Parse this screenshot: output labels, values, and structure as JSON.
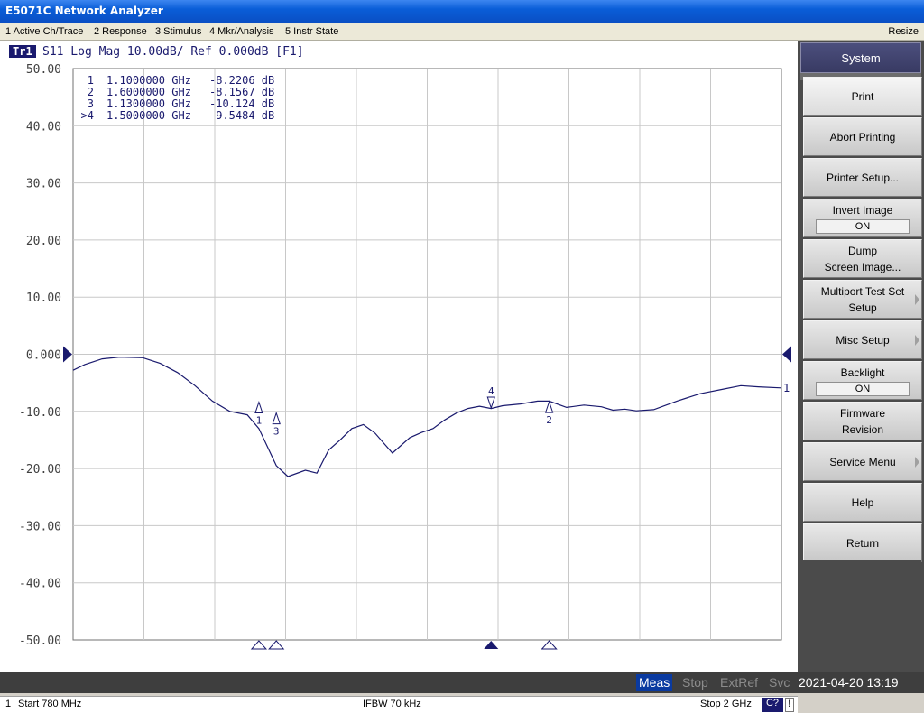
{
  "window": {
    "title": "E5071C Network Analyzer"
  },
  "menubar": {
    "items": [
      "1 Active Ch/Trace",
      "2 Response",
      "3 Stimulus",
      "4 Mkr/Analysis",
      "5 Instr State"
    ],
    "resize": "Resize"
  },
  "trace_header": {
    "tag": "Tr1",
    "text": "S11 Log Mag 10.00dB/ Ref 0.000dB [F1]"
  },
  "markers_table": [
    {
      "num": "1",
      "freq": "1.1000000 GHz",
      "val": "-8.2206 dB"
    },
    {
      "num": "2",
      "freq": "1.6000000 GHz",
      "val": "-8.1567 dB"
    },
    {
      "num": "3",
      "freq": "1.1300000 GHz",
      "val": "-10.124 dB"
    },
    {
      "num": ">4",
      "freq": "1.5000000 GHz",
      "val": "-9.5484 dB"
    }
  ],
  "bottom_bar": {
    "channel": "1",
    "start": "Start 780 MHz",
    "ifbw": "IFBW 70 kHz",
    "stop": "Stop 2 GHz",
    "cal": "C?",
    "warn": "!"
  },
  "softkeys": {
    "title": "System",
    "items": [
      {
        "label": "Print",
        "arrow": false,
        "selected": true
      },
      {
        "label": "Abort Printing",
        "arrow": false
      },
      {
        "label": "Printer Setup...",
        "arrow": false
      },
      {
        "label": "Invert Image",
        "value": "ON",
        "arrow": false
      },
      {
        "label": "Dump\nScreen Image...",
        "arrow": false
      },
      {
        "label": "Multiport Test Set\nSetup",
        "arrow": true
      },
      {
        "label": "Misc Setup",
        "arrow": true
      },
      {
        "label": "Backlight",
        "value": "ON",
        "arrow": false
      },
      {
        "label": "Firmware\nRevision",
        "arrow": false
      },
      {
        "label": "Service Menu",
        "arrow": true
      },
      {
        "label": "Help",
        "arrow": false
      },
      {
        "label": "Return",
        "arrow": false
      }
    ]
  },
  "status": {
    "meas": "Meas",
    "stop": "Stop",
    "extref": "ExtRef",
    "svc": "Svc",
    "datetime": "2021-04-20 13:19"
  },
  "chart_data": {
    "type": "line",
    "title": "",
    "xlabel": "",
    "ylabel": "",
    "x_unit": "GHz",
    "xlim": [
      0.78,
      2.0
    ],
    "ylim": [
      -50,
      50
    ],
    "y_tick_labels": [
      "50.00",
      "40.00",
      "30.00",
      "20.00",
      "10.00",
      "0.000",
      "-10.00",
      "-20.00",
      "-30.00",
      "-40.00",
      "-50.00"
    ],
    "y_ticks": [
      50,
      40,
      30,
      20,
      10,
      0,
      -10,
      -20,
      -30,
      -40,
      -50
    ],
    "grid": true,
    "ref_value": 0,
    "series": [
      {
        "name": "",
        "color": "#1a1a6e",
        "x": [
          0.78,
          0.8,
          0.83,
          0.86,
          0.9,
          0.93,
          0.96,
          0.99,
          1.02,
          1.05,
          1.08,
          1.1,
          1.13,
          1.15,
          1.18,
          1.2,
          1.22,
          1.24,
          1.26,
          1.28,
          1.3,
          1.33,
          1.36,
          1.38,
          1.4,
          1.42,
          1.44,
          1.46,
          1.48,
          1.5,
          1.52,
          1.55,
          1.58,
          1.6,
          1.63,
          1.66,
          1.69,
          1.71,
          1.73,
          1.75,
          1.78,
          1.82,
          1.86,
          1.9,
          1.93,
          1.96,
          2.0
        ],
        "y": [
          -2.8,
          -1.8,
          -0.8,
          -0.5,
          -0.6,
          -1.6,
          -3.2,
          -5.5,
          -8.2,
          -10.0,
          -10.6,
          -13.0,
          -19.5,
          -21.4,
          -20.3,
          -20.8,
          -16.8,
          -15.0,
          -13.0,
          -12.3,
          -13.8,
          -17.3,
          -14.6,
          -13.7,
          -13.0,
          -11.5,
          -10.3,
          -9.5,
          -9.1,
          -9.5,
          -9.0,
          -8.7,
          -8.2,
          -8.2,
          -9.3,
          -8.9,
          -9.2,
          -9.8,
          -9.6,
          -9.9,
          -9.7,
          -8.2,
          -6.9,
          -6.1,
          -5.5,
          -5.7,
          -5.9
        ]
      }
    ],
    "markers": [
      {
        "label": "1",
        "x": 1.1,
        "y": -8.2206,
        "active": false
      },
      {
        "label": "3",
        "x": 1.13,
        "y": -10.124,
        "active": false
      },
      {
        "label": "4",
        "x": 1.5,
        "y": -9.5484,
        "active": true
      },
      {
        "label": "2",
        "x": 1.6,
        "y": -8.1567,
        "active": false
      }
    ],
    "trace_end_label": "1"
  }
}
